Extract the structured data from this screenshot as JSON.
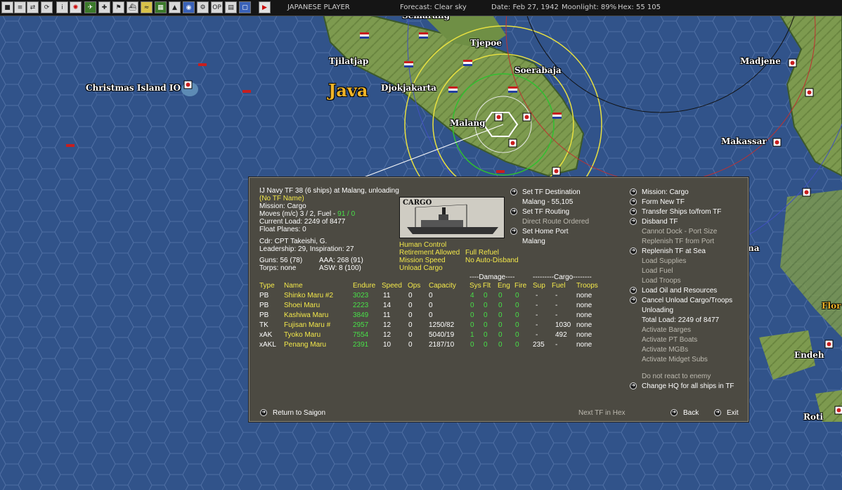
{
  "topbar": {
    "player": "JAPANESE PLAYER",
    "forecast": "Forecast: Clear sky",
    "date": "Date: Feb 27, 1942",
    "moonlight": "Moonlight: 89%",
    "hex": "Hex: 55 105"
  },
  "map": {
    "labels": [
      "Semarang",
      "Tjepoe",
      "Tjilatjap",
      "Soerabaja",
      "Madjene",
      "Christmas Island IO",
      "Java",
      "Djokjakarta",
      "Malang",
      "Makassar",
      "Endeh",
      "Roti",
      "Flor",
      "na"
    ]
  },
  "tf": {
    "header": "IJ Navy TF 38 (6 ships) at Malang, unloading",
    "name": "(No TF Name)",
    "mission": "Mission: Cargo",
    "moves": "Moves (m/c) 3 / 2, Fuel -",
    "fuel": "91 / 0",
    "load": "Current Load: 2249 of 8477",
    "float_planes": "Float Planes: 0",
    "cdr": "Cdr: CPT Takeishi, G.",
    "leadership": "Leadership: 29, Inspiration: 27",
    "guns": "Guns: 56 (78)",
    "aaa": "AAA: 268 (91)",
    "torps": "Torps: none",
    "asw": "ASW: 8 (100)",
    "image_label": "CARGO",
    "human_control": "Human Control",
    "retirement": "Retirement Allowed",
    "full_refuel": "Full Refuel",
    "mission_speed": "Mission Speed",
    "no_auto_disband": "No Auto-Disband",
    "unload_cargo": "Unload Cargo"
  },
  "mid_menu": {
    "set_destination": "Set TF Destination",
    "destination_value": "Malang - 55,105",
    "set_routing": "Set TF Routing",
    "routing_value": "Direct Route Ordered",
    "set_home": "Set Home Port",
    "home_value": "Malang"
  },
  "table": {
    "damage_group": "----Damage----",
    "cargo_group": "---------Cargo--------",
    "headers": [
      "Type",
      "Name",
      "Endure",
      "Speed",
      "Ops",
      "Capacity",
      "Sys",
      "Flt",
      "Eng",
      "Fire",
      "Sup",
      "Fuel",
      "Troops"
    ],
    "rows": [
      {
        "type": "PB",
        "name": "Shinko Maru #2",
        "endure": "3023",
        "speed": "11",
        "ops": "0",
        "capacity": "0",
        "sys": "4",
        "flt": "0",
        "eng": "0",
        "fire": "0",
        "sup": "-",
        "fuel": "-",
        "troops": "none"
      },
      {
        "type": "PB",
        "name": "Shoei Maru",
        "endure": "2223",
        "speed": "14",
        "ops": "0",
        "capacity": "0",
        "sys": "0",
        "flt": "0",
        "eng": "0",
        "fire": "0",
        "sup": "-",
        "fuel": "-",
        "troops": "none"
      },
      {
        "type": "PB",
        "name": "Kashiwa Maru",
        "endure": "3849",
        "speed": "11",
        "ops": "0",
        "capacity": "0",
        "sys": "0",
        "flt": "0",
        "eng": "0",
        "fire": "0",
        "sup": "-",
        "fuel": "-",
        "troops": "none"
      },
      {
        "type": "TK",
        "name": "Fujisan Maru #",
        "endure": "2957",
        "speed": "12",
        "ops": "0",
        "capacity": "1250/82",
        "sys": "0",
        "flt": "0",
        "eng": "0",
        "fire": "0",
        "sup": "-",
        "fuel": "1030",
        "troops": "none"
      },
      {
        "type": "xAK",
        "name": "Tyoko Maru",
        "endure": "7554",
        "speed": "12",
        "ops": "0",
        "capacity": "5040/19",
        "sys": "1",
        "flt": "0",
        "eng": "0",
        "fire": "0",
        "sup": "-",
        "fuel": "492",
        "troops": "none"
      },
      {
        "type": "xAKL",
        "name": "Penang Maru",
        "endure": "2391",
        "speed": "10",
        "ops": "0",
        "capacity": "2187/10",
        "sys": "0",
        "flt": "0",
        "eng": "0",
        "fire": "0",
        "sup": "235",
        "fuel": "-",
        "troops": "none"
      }
    ]
  },
  "right_menu": {
    "mission": "Mission: Cargo",
    "form_new": "Form New TF",
    "transfer": "Transfer Ships to/from TF",
    "disband": "Disband TF",
    "cannot_dock": "Cannot Dock - Port Size",
    "replenish_port": "Replenish TF from Port",
    "replenish_sea": "Replenish TF at Sea",
    "load_supplies": "Load Supplies",
    "load_fuel": "Load Fuel",
    "load_troops": "Load Troops",
    "load_oil": "Load Oil and Resources",
    "cancel_unload": "Cancel Unload Cargo/Troops",
    "unloading": "Unloading",
    "total_load": "Total Load: 2249 of 8477",
    "activate_barges": "Activate Barges",
    "activate_pt": "Activate PT Boats",
    "activate_mgb": "Activate MGBs",
    "activate_midget": "Activate Midget Subs",
    "no_react": "Do not react to enemy",
    "change_hq": "Change HQ for all ships in TF"
  },
  "footer": {
    "return": "Return to Saigon",
    "next_tf": "Next TF in Hex",
    "back": "Back",
    "exit": "Exit"
  }
}
